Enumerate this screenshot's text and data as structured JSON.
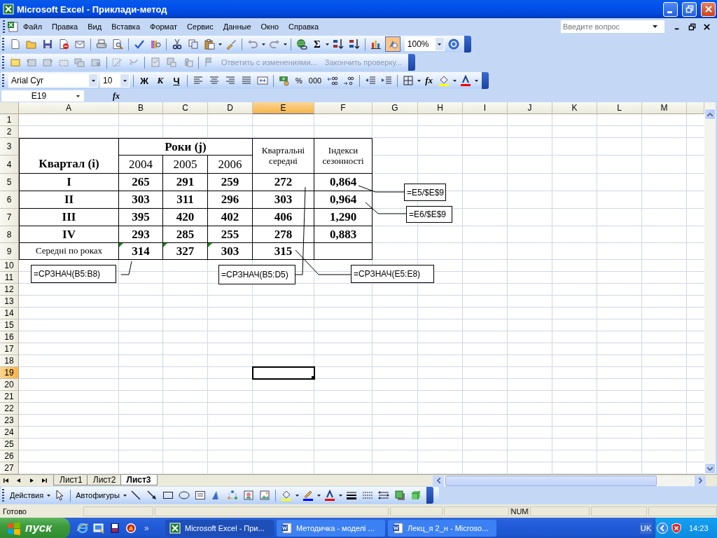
{
  "window": {
    "title": "Microsoft Excel - Приклади-метод"
  },
  "menu": {
    "items": [
      "Файл",
      "Правка",
      "Вид",
      "Вставка",
      "Формат",
      "Сервис",
      "Данные",
      "Окно",
      "Справка"
    ],
    "help_search": {
      "placeholder": "Введите вопрос"
    }
  },
  "standard_toolbar": {
    "sum": "Σ",
    "drawing_button": {
      "on": true
    },
    "zoom": "100%"
  },
  "review_toolbar": {
    "actions": [
      {
        "label": "Ответить с изменениями...",
        "disabled": true
      },
      {
        "label": "Закончить проверку...",
        "disabled": true
      }
    ]
  },
  "formatting_toolbar": {
    "font": "Arial Cyr",
    "size": "10",
    "style_buttons": [
      "Ж",
      "К",
      "Ч"
    ],
    "number_buttons": [
      "%",
      "000"
    ],
    "function_button": "fx"
  },
  "formula_bar": {
    "name_box": "E19",
    "function_button": "fx"
  },
  "sheet": {
    "columns": [
      {
        "label": "A",
        "selected": false
      },
      {
        "label": "B",
        "selected": false
      },
      {
        "label": "C",
        "selected": false
      },
      {
        "label": "D",
        "selected": false
      },
      {
        "label": "E",
        "selected": true
      },
      {
        "label": "F",
        "selected": false
      },
      {
        "label": "G",
        "selected": false
      },
      {
        "label": "H",
        "selected": false
      },
      {
        "label": "I",
        "selected": false
      },
      {
        "label": "J",
        "selected": false
      },
      {
        "label": "K",
        "selected": false
      },
      {
        "label": "L",
        "selected": false
      },
      {
        "label": "M",
        "selected": false
      }
    ],
    "rows": [
      {
        "label": "1",
        "selected": false
      },
      {
        "label": "2",
        "selected": false
      },
      {
        "label": "3",
        "selected": false
      },
      {
        "label": "4",
        "selected": false
      },
      {
        "label": "5",
        "selected": false
      },
      {
        "label": "6",
        "selected": false
      },
      {
        "label": "7",
        "selected": false
      },
      {
        "label": "8",
        "selected": false
      },
      {
        "label": "9",
        "selected": false
      },
      {
        "label": "10",
        "selected": false
      },
      {
        "label": "11",
        "selected": false
      },
      {
        "label": "12",
        "selected": false
      },
      {
        "label": "13",
        "selected": false
      },
      {
        "label": "14",
        "selected": false
      },
      {
        "label": "15",
        "selected": false
      },
      {
        "label": "16",
        "selected": false
      },
      {
        "label": "17",
        "selected": false
      },
      {
        "label": "18",
        "selected": false
      },
      {
        "label": "19",
        "selected": true
      },
      {
        "label": "20",
        "selected": false
      },
      {
        "label": "21",
        "selected": false
      },
      {
        "label": "22",
        "selected": false
      },
      {
        "label": "23",
        "selected": false
      },
      {
        "label": "24",
        "selected": false
      },
      {
        "label": "25",
        "selected": false
      },
      {
        "label": "26",
        "selected": false
      },
      {
        "label": "27",
        "selected": false
      }
    ]
  },
  "table": {
    "quarter_header": "Квартал (i)",
    "years_header": "Роки (j)",
    "years": [
      "2004",
      "2005",
      "2006"
    ],
    "average_header": "Квартальні середні",
    "index_header": "Індекси сезонності",
    "rows": [
      {
        "label": "I",
        "values": [
          "265",
          "291",
          "259"
        ],
        "average": "272",
        "index": "0,864"
      },
      {
        "label": "II",
        "values": [
          "303",
          "311",
          "296"
        ],
        "average": "303",
        "index": "0,964"
      },
      {
        "label": "III",
        "values": [
          "395",
          "420",
          "402"
        ],
        "average": "406",
        "index": "1,290"
      },
      {
        "label": "IV",
        "values": [
          "293",
          "285",
          "255"
        ],
        "average": "278",
        "index": "0,883"
      }
    ],
    "footer": {
      "label": "Середні по роках",
      "values": [
        {
          "value": "314",
          "error_mark": true
        },
        {
          "value": "327",
          "error_mark": true
        },
        {
          "value": "303",
          "error_mark": true
        }
      ],
      "average": "315"
    }
  },
  "callouts": [
    "=E5/$E$9",
    "=E6/$E$9",
    "=СРЗНАЧ(B5:B8)",
    "=СРЗНАЧ(B5:D5)",
    "=СРЗНАЧ(E5:E8)"
  ],
  "sheet_tabs": [
    {
      "label": "Лист1",
      "selected": false
    },
    {
      "label": "Лист2",
      "selected": false
    },
    {
      "label": "Лист3",
      "selected": true
    }
  ],
  "drawing_toolbar": {
    "actions": "Действия",
    "autoshapes": "Автофигуры"
  },
  "status_bar": {
    "status": "Готово",
    "indicator": "NUM"
  },
  "taskbar": {
    "start": "пуск",
    "more": "»",
    "tasks": [
      {
        "label": "Microsoft Excel - При...",
        "selected": true
      },
      {
        "label": "Методичка - моделі ...",
        "selected": false
      },
      {
        "label": "Лекц_я 2_н - Microso...",
        "selected": false
      }
    ],
    "language": "UK",
    "time": "14:23"
  }
}
